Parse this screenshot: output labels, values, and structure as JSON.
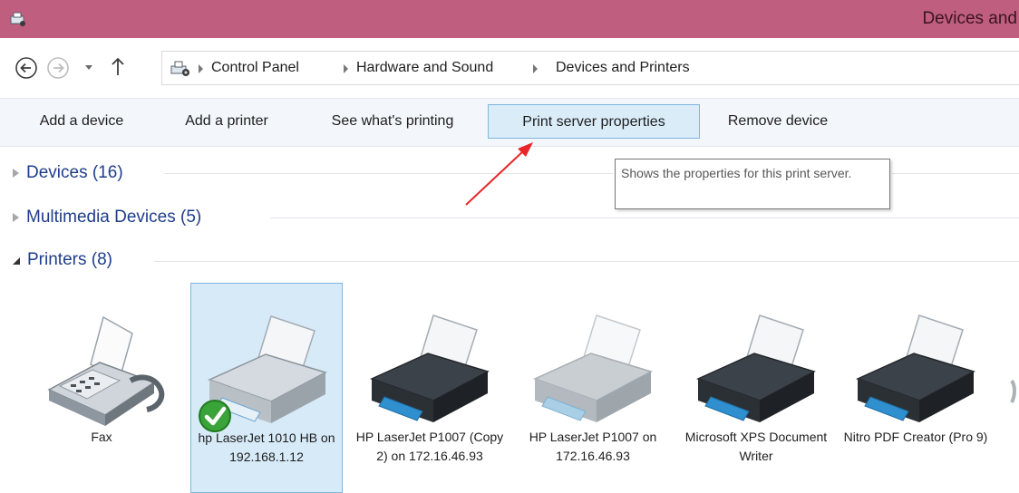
{
  "window": {
    "title": "Devices and"
  },
  "breadcrumb": [
    "Control Panel",
    "Hardware and Sound",
    "Devices and Printers"
  ],
  "toolbar": {
    "commands": [
      "Add a device",
      "Add a printer",
      "See what's printing",
      "Print server properties",
      "Remove device"
    ]
  },
  "groups": {
    "devices": "Devices (16)",
    "multimedia": "Multimedia Devices (5)",
    "printers": "Printers (8)"
  },
  "tooltip": {
    "text": "Shows the properties for this print server."
  },
  "printers": [
    {
      "label": "Fax",
      "icon": "fax-icon"
    },
    {
      "label": "hp LaserJet 1010 HB on 192.168.1.12",
      "icon": "printer-icon",
      "selected": true,
      "default": true
    },
    {
      "label": "HP LaserJet P1007 (Copy 2) on 172.16.46.93",
      "icon": "printer-icon"
    },
    {
      "label": "HP LaserJet P1007 on 172.16.46.93",
      "icon": "printer-icon"
    },
    {
      "label": "Microsoft XPS Document Writer",
      "icon": "printer-icon"
    },
    {
      "label": "Nitro PDF Creator (Pro 9)",
      "icon": "printer-icon"
    }
  ],
  "colors": {
    "titlebar": "#bf5e7f",
    "commandbar": "#f3f6fb",
    "group_heading": "#1f3d8b",
    "selection": "#d7eaf8",
    "annotation_arrow": "#e8262a"
  }
}
